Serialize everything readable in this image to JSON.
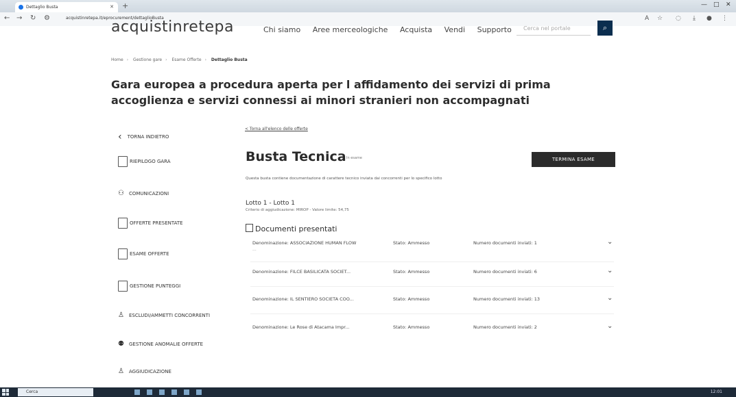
{
  "browser": {
    "tab_title": "Dettaglio Busta",
    "url": "acquistinretepa.it/eprocurement/dettaglioBusta",
    "new_tab": "+",
    "minimize": "—",
    "maximize": "□",
    "close": "✕"
  },
  "site": {
    "logo": "acquistinretepa",
    "nav": [
      "Chi siamo",
      "Aree merceologiche",
      "Acquista",
      "Vendi",
      "Supporto"
    ],
    "search_placeholder": "Cerca nel portale"
  },
  "breadcrumb": [
    "Home",
    "Gestione gare",
    "Esame Offerte",
    "Dettaglio Busta"
  ],
  "page_title": "Gara europea a procedura aperta per l affidamento dei servizi di prima accoglienza e servizi connessi ai minori stranieri non accompagnati",
  "sidebar": {
    "back": "TORNA INDIETRO",
    "items": [
      {
        "label": "RIEPILOGO GARA"
      },
      {
        "label": "COMUNICAZIONI"
      },
      {
        "label": "OFFERTE PRESENTATE"
      },
      {
        "label": "ESAME OFFERTE"
      },
      {
        "label": "GESTIONE PUNTEGGI"
      },
      {
        "label": "ESCLUDI/AMMETTI CONCORRENTI"
      },
      {
        "label": "GESTIONE ANOMALIE OFFERTE"
      },
      {
        "label": "AGGIUDICAZIONE"
      }
    ]
  },
  "main": {
    "back_link": "< Torna all'elenco delle offerte",
    "title": "Busta Tecnica",
    "badge": "In esame",
    "action_button": "TERMINA ESAME",
    "description": "Questa busta contiene documentazione di carattere tecnico inviata dai concorrenti per lo specifico lotto",
    "lotto": "Lotto 1 - Lotto 1",
    "criterio": "Criterio di aggiudicazione: MIROP - Valore limite: 54,75",
    "documents_heading": "Documenti presentati",
    "documents": [
      {
        "denominazione": "Denominazione: ASSOCIAZIONE HUMAN FLOW",
        "sub": "...",
        "stato": "Stato: Ammesso",
        "numero": "Numero documenti inviati: 1"
      },
      {
        "denominazione": "Denominazione: FILCE BASILICATA SOCIET...",
        "sub": "",
        "stato": "Stato: Ammesso",
        "numero": "Numero documenti inviati: 6"
      },
      {
        "denominazione": "Denominazione: IL SENTIERO SOCIETA COO...",
        "sub": "",
        "stato": "Stato: Ammesso",
        "numero": "Numero documenti inviati: 13"
      },
      {
        "denominazione": "Denominazione: Le Rose di Atacama Impr...",
        "sub": "",
        "stato": "Stato: Ammesso",
        "numero": "Numero documenti inviati: 2"
      }
    ]
  },
  "taskbar": {
    "search": "Cerca",
    "clock": "12:01"
  }
}
